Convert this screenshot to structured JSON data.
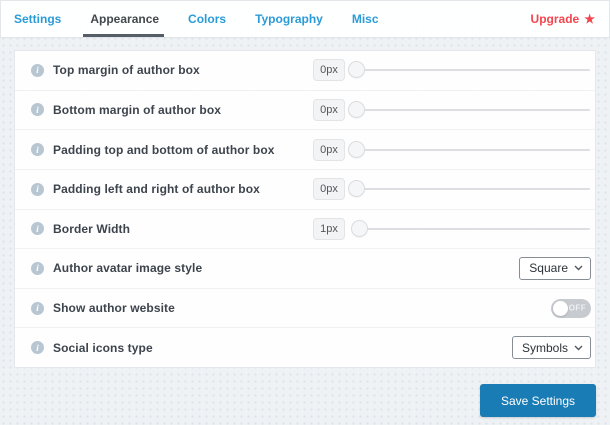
{
  "tabs": [
    {
      "label": "Settings",
      "active": false
    },
    {
      "label": "Appearance",
      "active": true
    },
    {
      "label": "Colors",
      "active": false
    },
    {
      "label": "Typography",
      "active": false
    },
    {
      "label": "Misc",
      "active": false
    }
  ],
  "upgrade": {
    "label": "Upgrade"
  },
  "icons": {
    "info_glyph": "i",
    "star_glyph": "★"
  },
  "rows": [
    {
      "type": "slider",
      "label": "Top margin of author box",
      "value": "0px"
    },
    {
      "type": "slider",
      "label": "Bottom margin of author box",
      "value": "0px"
    },
    {
      "type": "slider",
      "label": "Padding top and bottom of author box",
      "value": "0px"
    },
    {
      "type": "slider",
      "label": "Padding left and right of author box",
      "value": "0px"
    },
    {
      "type": "slider",
      "label": "Border Width",
      "value": "1px"
    },
    {
      "type": "select",
      "label": "Author avatar image style",
      "value": "Square"
    },
    {
      "type": "toggle",
      "label": "Show author website",
      "value": "OFF",
      "state": "off"
    },
    {
      "type": "select",
      "label": "Social icons type",
      "value": "Symbols"
    }
  ],
  "footer": {
    "save_label": "Save Settings"
  },
  "colors": {
    "tab_link": "#2b9bd7",
    "tab_active": "#43484d",
    "upgrade_red": "#f2464f",
    "info_icon": "#b7c6d1",
    "save_button": "#1a7cb4",
    "page_bg": "#eff2f5"
  }
}
